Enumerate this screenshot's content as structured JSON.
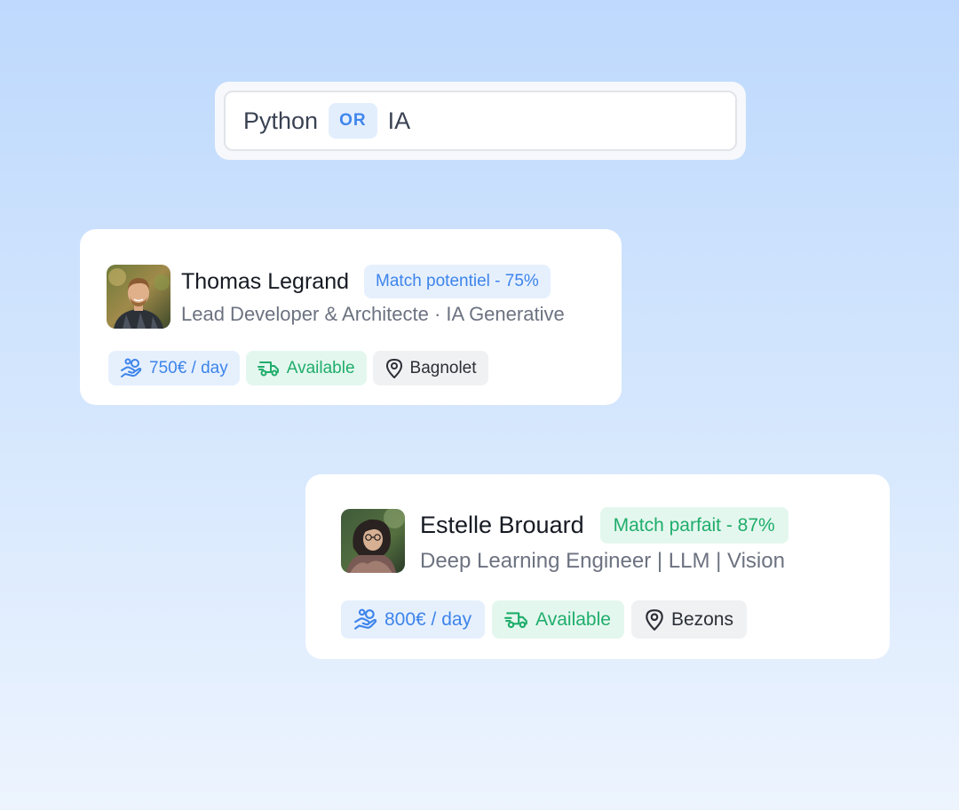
{
  "search": {
    "term_1": "Python",
    "operator": "OR",
    "term_2": "IA"
  },
  "candidates": [
    {
      "name": "Thomas Legrand",
      "match": "Match potentiel - 75%",
      "title": "Lead Developer & Architecte · IA Generative",
      "rate": "750€ / day",
      "availability": "Available",
      "location": "Bagnolet",
      "avatar_icon": "avatar-photo"
    },
    {
      "name": "Estelle Brouard",
      "match": "Match parfait - 87%",
      "title": "Deep Learning Engineer | LLM | Vision",
      "rate": "800€ / day",
      "availability": "Available",
      "location": "Bezons",
      "avatar_icon": "avatar-photo"
    }
  ],
  "icons": {
    "rate": "hand-coins-icon",
    "availability": "truck-fast-icon",
    "location": "map-pin-icon"
  },
  "colors": {
    "accent_blue": "#3d84ea",
    "accent_green": "#1fad6c",
    "blue_bg": "#e6f0fd",
    "green_bg": "#e4f7ee"
  }
}
